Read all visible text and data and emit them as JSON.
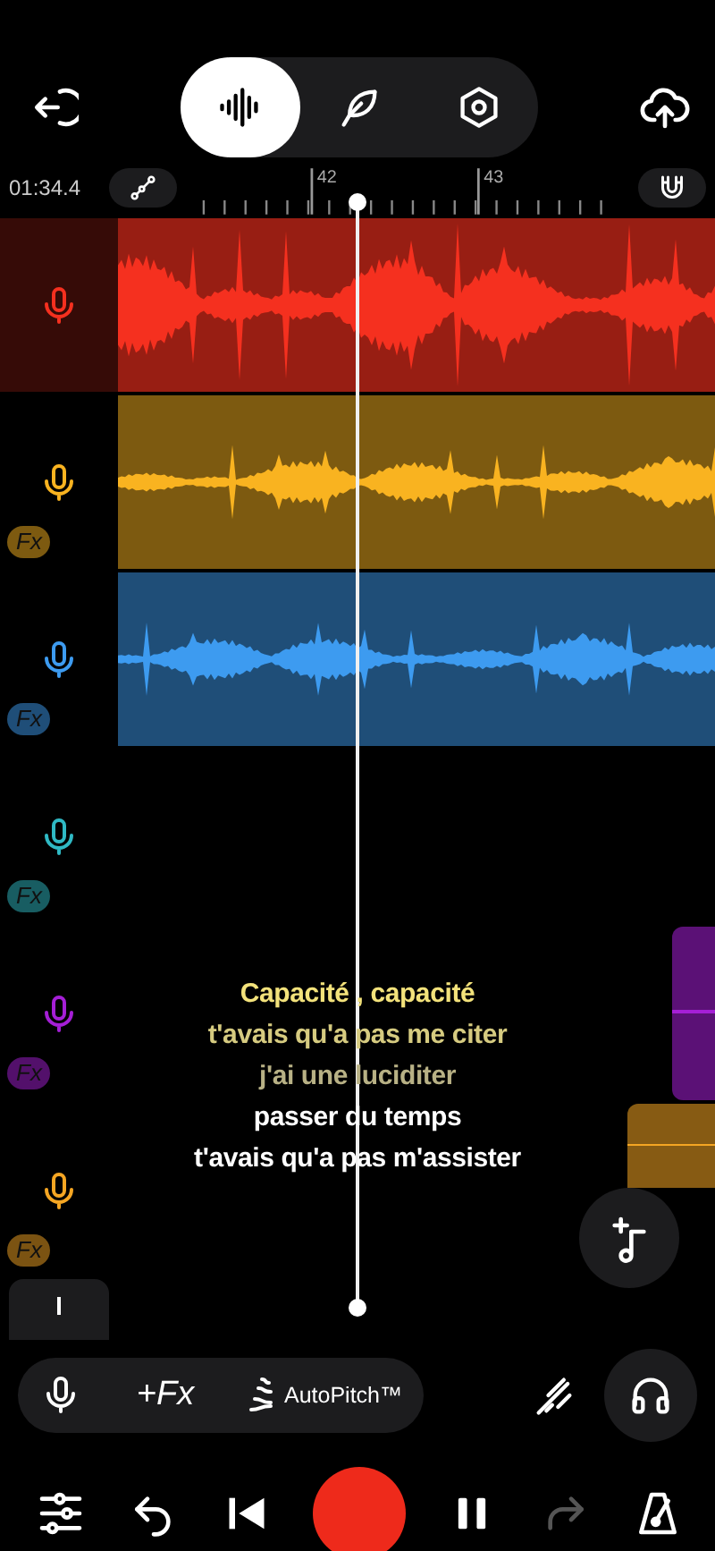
{
  "tabs": [
    {
      "selected": true
    },
    {
      "selected": false
    },
    {
      "selected": false
    }
  ],
  "ruler": {
    "time": "01:34.4",
    "labels": [
      "42",
      "43"
    ],
    "link_on": false,
    "snap_on": false
  },
  "tracks": [
    {
      "color": "#f5301f",
      "selected": true,
      "clip": {
        "kind": "waveform"
      }
    },
    {
      "color": "#f9b320",
      "selected": false,
      "fx": "Fx",
      "clip": {
        "kind": "waveform"
      }
    },
    {
      "color": "#3d9bf0",
      "selected": false,
      "fx": "Fx",
      "clip": {
        "kind": "waveform"
      }
    },
    {
      "color": "#2fb9c4",
      "selected": false,
      "fx": "Fx"
    },
    {
      "color": "#a51fd6",
      "selected": false,
      "fx": "Fx",
      "clip": {
        "kind": "sliver"
      }
    },
    {
      "color": "#f5a623",
      "selected": false,
      "fx": "Fx",
      "clip": {
        "kind": "stub"
      }
    }
  ],
  "lyrics": [
    {
      "text": "Capacité , capacité",
      "kind": "current"
    },
    {
      "text": "t'avais qu'a pas me citer",
      "kind": "next"
    },
    {
      "text": "j'ai une luciditer",
      "kind": "later"
    },
    {
      "text": "passer du temps",
      "kind": "upcoming"
    },
    {
      "text": "t'avais qu'a pas m'assister",
      "kind": "upcoming"
    }
  ],
  "toolbar": {
    "fx": "+Fx",
    "autopitch": "AutoPitch™"
  },
  "transport": {
    "redo_disabled": true
  }
}
